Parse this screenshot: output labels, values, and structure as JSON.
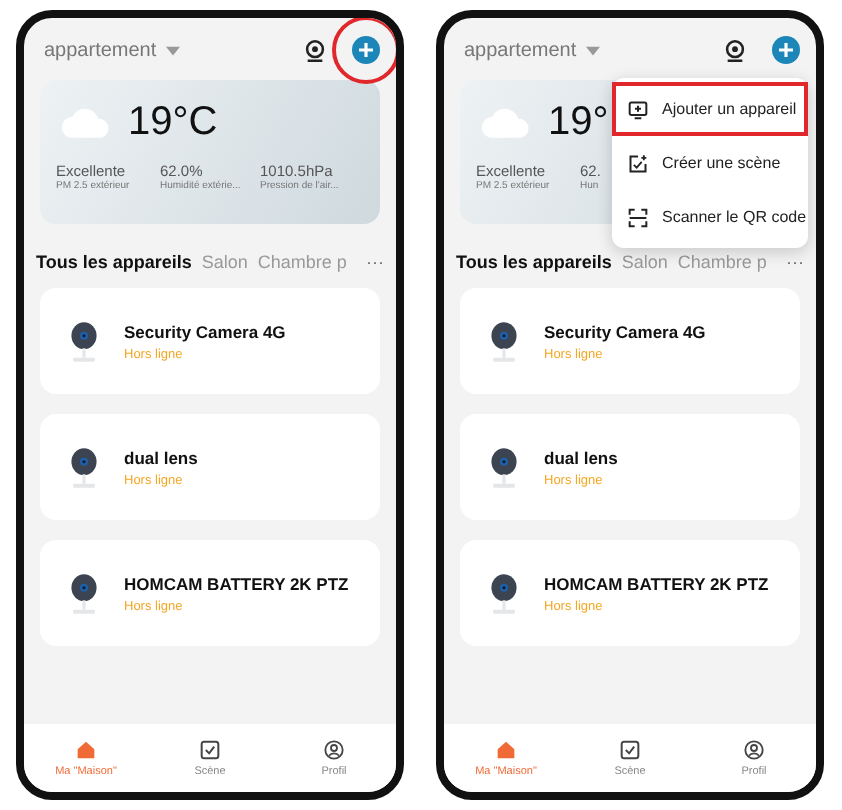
{
  "phones": [
    {
      "header": {
        "location": "appartement",
        "add_circled": true
      },
      "weather": {
        "temperature": "19°C",
        "stats": [
          {
            "value": "Excellente",
            "label": "PM 2.5 extérieur"
          },
          {
            "value": "62.0%",
            "label": "Humidité extérie..."
          },
          {
            "value": "1010.5hPa",
            "label": "Pression de l'air..."
          }
        ]
      },
      "tabs": [
        {
          "label": "Tous les appareils",
          "selected": true
        },
        {
          "label": "Salon",
          "selected": false
        },
        {
          "label": "Chambre p",
          "selected": false
        }
      ],
      "more": "···",
      "devices": [
        {
          "name": "Security Camera 4G",
          "status": "Hors ligne"
        },
        {
          "name": "dual lens",
          "status": "Hors ligne"
        },
        {
          "name": "HOMCAM BATTERY 2K PTZ",
          "status": "Hors ligne"
        }
      ],
      "nav": [
        {
          "kind": "home",
          "label": "Ma \"Maison\"",
          "selected": true
        },
        {
          "kind": "scene",
          "label": "Scène",
          "selected": false
        },
        {
          "kind": "profile",
          "label": "Profil",
          "selected": false
        }
      ]
    },
    {
      "header": {
        "location": "appartement",
        "add_circled": false
      },
      "weather": {
        "temperature": "19°",
        "stats": [
          {
            "value": "Excellente",
            "label": "PM 2.5 extérieur"
          },
          {
            "value": "62.",
            "label": "Hun"
          }
        ]
      },
      "menu": [
        {
          "kind": "add",
          "label": "Ajouter un appareil",
          "highlighted": true
        },
        {
          "kind": "scene",
          "label": "Créer une scène",
          "highlighted": false
        },
        {
          "kind": "scan",
          "label": "Scanner le QR code",
          "highlighted": false
        }
      ],
      "tabs": [
        {
          "label": "Tous les appareils",
          "selected": true
        },
        {
          "label": "Salon",
          "selected": false
        },
        {
          "label": "Chambre p",
          "selected": false
        }
      ],
      "more": "···",
      "devices": [
        {
          "name": "Security Camera 4G",
          "status": "Hors ligne"
        },
        {
          "name": "dual lens",
          "status": "Hors ligne"
        },
        {
          "name": "HOMCAM BATTERY 2K PTZ",
          "status": "Hors ligne"
        }
      ],
      "nav": [
        {
          "kind": "home",
          "label": "Ma \"Maison\"",
          "selected": true
        },
        {
          "kind": "scene",
          "label": "Scène",
          "selected": false
        },
        {
          "kind": "profile",
          "label": "Profil",
          "selected": false
        }
      ]
    }
  ]
}
